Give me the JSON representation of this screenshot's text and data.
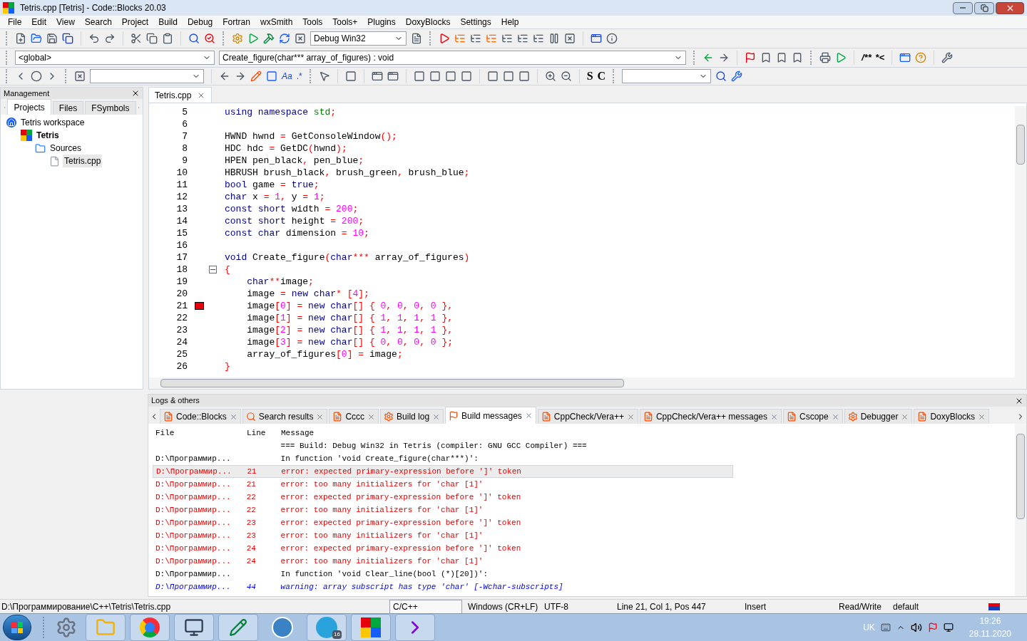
{
  "window": {
    "title": "Tetris.cpp [Tetris] - Code::Blocks 20.03"
  },
  "menu": [
    "File",
    "Edit",
    "View",
    "Search",
    "Project",
    "Build",
    "Debug",
    "Fortran",
    "wxSmith",
    "Tools",
    "Tools+",
    "Plugins",
    "DoxyBlocks",
    "Settings",
    "Help"
  ],
  "toolbars": {
    "build_target": "Debug Win32",
    "scope": "<global>",
    "function": "Create_figure(char*** array_of_figures) : void",
    "match_case": "Aa",
    "regex": ".*",
    "doc_comment": "/**",
    "inline_comment": "*<",
    "step_s": "S",
    "step_c": "C"
  },
  "management": {
    "title": "Management",
    "tabs": [
      {
        "label": "Projects",
        "selected": true
      },
      {
        "label": "Files",
        "selected": false
      },
      {
        "label": "FSymbols",
        "selected": false
      }
    ],
    "tree": [
      {
        "label": "Tetris workspace",
        "kind": "workspace",
        "selected": false,
        "children": [
          {
            "label": "Tetris",
            "kind": "project",
            "selected": false,
            "children": [
              {
                "label": "Sources",
                "kind": "folder",
                "selected": false,
                "children": [
                  {
                    "label": "Tetris.cpp",
                    "kind": "file",
                    "selected": true
                  }
                ]
              }
            ]
          }
        ]
      }
    ]
  },
  "editor": {
    "tabs": [
      {
        "label": "Tetris.cpp",
        "selected": true
      }
    ],
    "lines": [
      {
        "number": "5",
        "tokens": [
          {
            "kind": "kw",
            "text": "using"
          },
          {
            "kind": "kw",
            "text": " namespace"
          },
          {
            "kind": "std",
            "text": " std"
          },
          {
            "kind": "op",
            "text": ";"
          }
        ]
      },
      {
        "number": "6"
      },
      {
        "number": "7",
        "tokens": [
          {
            "kind": "id",
            "text": "HWND hwnd "
          },
          {
            "kind": "op",
            "text": "="
          },
          {
            "kind": "id",
            "text": " GetConsoleWindow"
          },
          {
            "kind": "op",
            "text": "();"
          }
        ]
      },
      {
        "number": "8",
        "tokens": [
          {
            "kind": "id",
            "text": "HDC hdc "
          },
          {
            "kind": "op",
            "text": "="
          },
          {
            "kind": "id",
            "text": " GetDC"
          },
          {
            "kind": "op",
            "text": "("
          },
          {
            "kind": "id",
            "text": "hwnd"
          },
          {
            "kind": "op",
            "text": ");"
          }
        ]
      },
      {
        "number": "9",
        "tokens": [
          {
            "kind": "id",
            "text": "HPEN pen_black"
          },
          {
            "kind": "op",
            "text": ","
          },
          {
            "kind": "id",
            "text": " pen_blue"
          },
          {
            "kind": "op",
            "text": ";"
          }
        ]
      },
      {
        "number": "10",
        "tokens": [
          {
            "kind": "id",
            "text": "HBRUSH brush_black"
          },
          {
            "kind": "op",
            "text": ","
          },
          {
            "kind": "id",
            "text": " brush_green"
          },
          {
            "kind": "op",
            "text": ","
          },
          {
            "kind": "id",
            "text": " brush_blue"
          },
          {
            "kind": "op",
            "text": ";"
          }
        ]
      },
      {
        "number": "11",
        "tokens": [
          {
            "kind": "kw",
            "text": "bool"
          },
          {
            "kind": "id",
            "text": " game "
          },
          {
            "kind": "op",
            "text": "="
          },
          {
            "kind": "kw",
            "text": " true"
          },
          {
            "kind": "op",
            "text": ";"
          }
        ]
      },
      {
        "number": "12",
        "tokens": [
          {
            "kind": "kw",
            "text": "char"
          },
          {
            "kind": "id",
            "text": " x "
          },
          {
            "kind": "op",
            "text": "="
          },
          {
            "kind": "num",
            "text": " 1"
          },
          {
            "kind": "op",
            "text": ","
          },
          {
            "kind": "id",
            "text": " y "
          },
          {
            "kind": "op",
            "text": "="
          },
          {
            "kind": "num",
            "text": " 1"
          },
          {
            "kind": "op",
            "text": ";"
          }
        ]
      },
      {
        "number": "13",
        "tokens": [
          {
            "kind": "kw",
            "text": "const short"
          },
          {
            "kind": "id",
            "text": " width "
          },
          {
            "kind": "op",
            "text": "="
          },
          {
            "kind": "num",
            "text": " 200"
          },
          {
            "kind": "op",
            "text": ";"
          }
        ]
      },
      {
        "number": "14",
        "tokens": [
          {
            "kind": "kw",
            "text": "const short"
          },
          {
            "kind": "id",
            "text": " height "
          },
          {
            "kind": "op",
            "text": "="
          },
          {
            "kind": "num",
            "text": " 200"
          },
          {
            "kind": "op",
            "text": ";"
          }
        ]
      },
      {
        "number": "15",
        "tokens": [
          {
            "kind": "kw",
            "text": "const char"
          },
          {
            "kind": "id",
            "text": " dimension "
          },
          {
            "kind": "op",
            "text": "="
          },
          {
            "kind": "num",
            "text": " 10"
          },
          {
            "kind": "op",
            "text": ";"
          }
        ]
      },
      {
        "number": "16"
      },
      {
        "number": "17",
        "tokens": [
          {
            "kind": "kw",
            "text": "void"
          },
          {
            "kind": "id",
            "text": " Create_figure"
          },
          {
            "kind": "op",
            "text": "("
          },
          {
            "kind": "kw",
            "text": "char"
          },
          {
            "kind": "op",
            "text": "***"
          },
          {
            "kind": "id",
            "text": " array_of_figures"
          },
          {
            "kind": "op",
            "text": ")"
          }
        ]
      },
      {
        "number": "18",
        "kind": "fold",
        "tokens": [
          {
            "kind": "op",
            "text": "{"
          }
        ]
      },
      {
        "number": "19",
        "tokens": [
          {
            "kind": "kw",
            "text": "    char"
          },
          {
            "kind": "op",
            "text": "**"
          },
          {
            "kind": "id",
            "text": "image"
          },
          {
            "kind": "op",
            "text": ";"
          }
        ]
      },
      {
        "number": "20",
        "tokens": [
          {
            "kind": "id",
            "text": "    image "
          },
          {
            "kind": "op",
            "text": "="
          },
          {
            "kind": "kw",
            "text": " new char"
          },
          {
            "kind": "op",
            "text": "*"
          },
          {
            "kind": "op",
            "text": " ["
          },
          {
            "kind": "num",
            "text": "4"
          },
          {
            "kind": "op",
            "text": "];"
          }
        ]
      },
      {
        "number": "21",
        "kind": "error",
        "tokens": [
          {
            "kind": "id",
            "text": "    image"
          },
          {
            "kind": "op",
            "text": "["
          },
          {
            "kind": "num",
            "text": "0"
          },
          {
            "kind": "op",
            "text": "]"
          },
          {
            "kind": "op",
            "text": " ="
          },
          {
            "kind": "kw",
            "text": " new char"
          },
          {
            "kind": "op",
            "text": "[]"
          },
          {
            "kind": "op",
            "text": " {"
          },
          {
            "kind": "num",
            "text": " 0"
          },
          {
            "kind": "op",
            "text": ","
          },
          {
            "kind": "num",
            "text": " 0"
          },
          {
            "kind": "op",
            "text": ","
          },
          {
            "kind": "num",
            "text": " 0"
          },
          {
            "kind": "op",
            "text": ","
          },
          {
            "kind": "num",
            "text": " 0"
          },
          {
            "kind": "op",
            "text": " },"
          }
        ]
      },
      {
        "number": "22",
        "tokens": [
          {
            "kind": "id",
            "text": "    image"
          },
          {
            "kind": "op",
            "text": "["
          },
          {
            "kind": "num",
            "text": "1"
          },
          {
            "kind": "op",
            "text": "]"
          },
          {
            "kind": "op",
            "text": " ="
          },
          {
            "kind": "kw",
            "text": " new char"
          },
          {
            "kind": "op",
            "text": "[]"
          },
          {
            "kind": "op",
            "text": " {"
          },
          {
            "kind": "num",
            "text": " 1"
          },
          {
            "kind": "op",
            "text": ","
          },
          {
            "kind": "num",
            "text": " 1"
          },
          {
            "kind": "op",
            "text": ","
          },
          {
            "kind": "num",
            "text": " 1"
          },
          {
            "kind": "op",
            "text": ","
          },
          {
            "kind": "num",
            "text": " 1"
          },
          {
            "kind": "op",
            "text": " },"
          }
        ]
      },
      {
        "number": "23",
        "tokens": [
          {
            "kind": "id",
            "text": "    image"
          },
          {
            "kind": "op",
            "text": "["
          },
          {
            "kind": "num",
            "text": "2"
          },
          {
            "kind": "op",
            "text": "]"
          },
          {
            "kind": "op",
            "text": " ="
          },
          {
            "kind": "kw",
            "text": " new char"
          },
          {
            "kind": "op",
            "text": "[]"
          },
          {
            "kind": "op",
            "text": " {"
          },
          {
            "kind": "num",
            "text": " 1"
          },
          {
            "kind": "op",
            "text": ","
          },
          {
            "kind": "num",
            "text": " 1"
          },
          {
            "kind": "op",
            "text": ","
          },
          {
            "kind": "num",
            "text": " 1"
          },
          {
            "kind": "op",
            "text": ","
          },
          {
            "kind": "num",
            "text": " 1"
          },
          {
            "kind": "op",
            "text": " },"
          }
        ]
      },
      {
        "number": "24",
        "tokens": [
          {
            "kind": "id",
            "text": "    image"
          },
          {
            "kind": "op",
            "text": "["
          },
          {
            "kind": "num",
            "text": "3"
          },
          {
            "kind": "op",
            "text": "]"
          },
          {
            "kind": "op",
            "text": " ="
          },
          {
            "kind": "kw",
            "text": " new char"
          },
          {
            "kind": "op",
            "text": "[]"
          },
          {
            "kind": "op",
            "text": " {"
          },
          {
            "kind": "num",
            "text": " 0"
          },
          {
            "kind": "op",
            "text": ","
          },
          {
            "kind": "num",
            "text": " 0"
          },
          {
            "kind": "op",
            "text": ","
          },
          {
            "kind": "num",
            "text": " 0"
          },
          {
            "kind": "op",
            "text": ","
          },
          {
            "kind": "num",
            "text": " 0"
          },
          {
            "kind": "op",
            "text": " };"
          }
        ]
      },
      {
        "number": "25",
        "tokens": [
          {
            "kind": "id",
            "text": "    array_of_figures"
          },
          {
            "kind": "op",
            "text": "["
          },
          {
            "kind": "num",
            "text": "0"
          },
          {
            "kind": "op",
            "text": "]"
          },
          {
            "kind": "op",
            "text": " ="
          },
          {
            "kind": "id",
            "text": " image"
          },
          {
            "kind": "op",
            "text": ";"
          }
        ]
      },
      {
        "number": "26",
        "tokens": [
          {
            "kind": "op",
            "text": "}"
          }
        ]
      }
    ]
  },
  "logs": {
    "title": "Logs & others",
    "tabs": [
      {
        "label": "Code::Blocks",
        "selected": false
      },
      {
        "label": "Search results",
        "selected": false
      },
      {
        "label": "Cccc",
        "selected": false
      },
      {
        "label": "Build log",
        "selected": false
      },
      {
        "label": "Build messages",
        "selected": true
      },
      {
        "label": "CppCheck/Vera++",
        "selected": false
      },
      {
        "label": "CppCheck/Vera++ messages",
        "selected": false
      },
      {
        "label": "Cscope",
        "selected": false
      },
      {
        "label": "Debugger",
        "selected": false
      },
      {
        "label": "DoxyBlocks",
        "selected": false
      }
    ],
    "columns": [
      "File",
      "Line",
      "Message"
    ],
    "rows": [
      {
        "kind": "info",
        "selected": false,
        "message": "=== Build: Debug Win32 in Tetris (compiler: GNU GCC Compiler) ==="
      },
      {
        "kind": "info",
        "selected": false,
        "file": "D:\\Программир...",
        "message": "In function 'void Create_figure(char***)':"
      },
      {
        "kind": "error",
        "selected": true,
        "file": "D:\\Программир...",
        "line": "21",
        "message": "error: expected primary-expression before ']' token"
      },
      {
        "kind": "error",
        "selected": false,
        "file": "D:\\Программир...",
        "line": "21",
        "message": "error: too many initializers for 'char [1]'"
      },
      {
        "kind": "error",
        "selected": false,
        "file": "D:\\Программир...",
        "line": "22",
        "message": "error: expected primary-expression before ']' token"
      },
      {
        "kind": "error",
        "selected": false,
        "file": "D:\\Программир...",
        "line": "22",
        "message": "error: too many initializers for 'char [1]'"
      },
      {
        "kind": "error",
        "selected": false,
        "file": "D:\\Программир...",
        "line": "23",
        "message": "error: expected primary-expression before ']' token"
      },
      {
        "kind": "error",
        "selected": false,
        "file": "D:\\Программир...",
        "line": "23",
        "message": "error: too many initializers for 'char [1]'"
      },
      {
        "kind": "error",
        "selected": false,
        "file": "D:\\Программир...",
        "line": "24",
        "message": "error: expected primary-expression before ']' token"
      },
      {
        "kind": "error",
        "selected": false,
        "file": "D:\\Программир...",
        "line": "24",
        "message": "error: too many initializers for 'char [1]'"
      },
      {
        "kind": "info",
        "selected": false,
        "file": "D:\\Программир...",
        "message": "In function 'void Clear_line(bool (*)[20])':"
      },
      {
        "kind": "warning",
        "selected": false,
        "file": "D:\\Программир...",
        "line": "44",
        "message": "warning: array subscript has type 'char' [-Wchar-subscripts]"
      }
    ]
  },
  "status_bar": {
    "path": "D:\\Программирование\\C++\\Tetris\\Tetris.cpp",
    "language": "C/C++",
    "eol": "Windows (CR+LF)",
    "encoding": "UTF-8",
    "position": "Line 21, Col 1, Pos 447",
    "mode": "Insert",
    "access": "Read/Write",
    "profile": "default"
  },
  "taskbar": {
    "telegram_badge": "16",
    "language": "UK",
    "time": "19:26",
    "date": "28.11.2020"
  }
}
